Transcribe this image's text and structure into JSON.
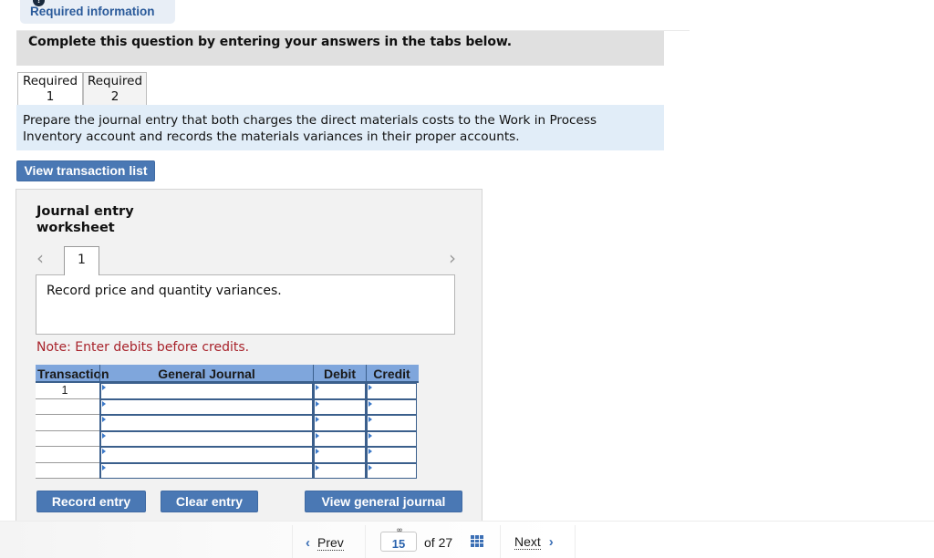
{
  "header": {
    "required_info_label": "Required information",
    "alert_icon": "!",
    "instruction": "Complete this question by entering your answers in the tabs below."
  },
  "tabs": [
    {
      "line1": "Required",
      "line2": "1",
      "active": true
    },
    {
      "line1": "Required",
      "line2": "2",
      "active": false
    }
  ],
  "prompt": "Prepare the journal entry that both charges the direct materials costs to the Work in Process Inventory account and records the materials variances in their proper accounts.",
  "view_transaction_list_label": "View transaction list",
  "worksheet": {
    "title_line1": "Journal entry",
    "title_line2": "worksheet",
    "prev_icon": "‹",
    "next_icon": "›",
    "current_entry": "1",
    "description": "Record price and quantity variances.",
    "note": "Note: Enter debits before credits.",
    "table": {
      "headers": {
        "transaction": "Transaction",
        "general_journal": "General Journal",
        "debit": "Debit",
        "credit": "Credit"
      },
      "rows": [
        {
          "transaction": "1",
          "account": "",
          "debit": "",
          "credit": ""
        },
        {
          "transaction": "",
          "account": "",
          "debit": "",
          "credit": ""
        },
        {
          "transaction": "",
          "account": "",
          "debit": "",
          "credit": ""
        },
        {
          "transaction": "",
          "account": "",
          "debit": "",
          "credit": ""
        },
        {
          "transaction": "",
          "account": "",
          "debit": "",
          "credit": ""
        },
        {
          "transaction": "",
          "account": "",
          "debit": "",
          "credit": ""
        }
      ]
    },
    "buttons": {
      "record": "Record entry",
      "clear": "Clear entry",
      "view_general_journal": "View general journal"
    }
  },
  "footer": {
    "prev_label": "Prev",
    "next_label": "Next",
    "prev_icon": "‹",
    "next_icon": "›",
    "current_page": "15",
    "of_label": "of 27",
    "link_icon": "∞"
  },
  "colors": {
    "accent": "#4a78b4",
    "header_blue": "#7fa6dc",
    "note_red": "#a8232b",
    "prompt_bg": "#e1edf8"
  }
}
